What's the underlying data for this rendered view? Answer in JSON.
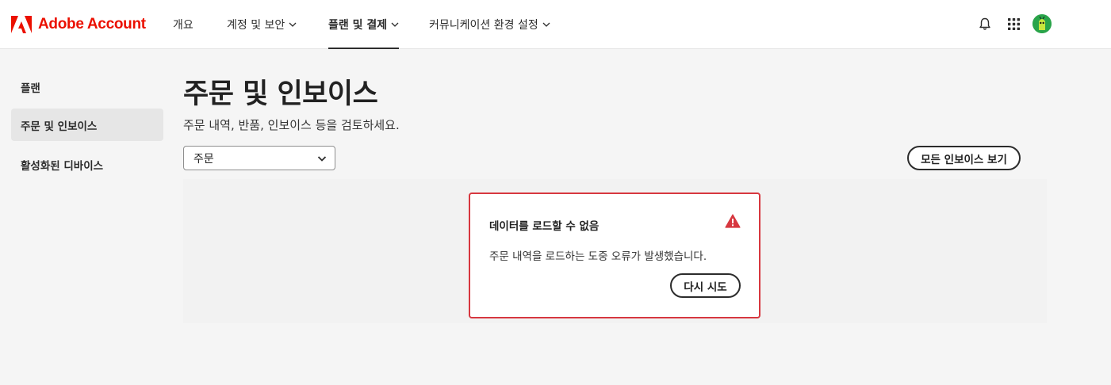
{
  "header": {
    "brand": "Adobe Account",
    "nav": [
      {
        "label": "개요",
        "has_dropdown": false
      },
      {
        "label": "계정 및 보안",
        "has_dropdown": true
      },
      {
        "label": "플랜 및 결제",
        "has_dropdown": true,
        "active": true
      },
      {
        "label": "커뮤니케이션 환경 설정",
        "has_dropdown": true
      }
    ],
    "icons": [
      "bell-icon",
      "apps-grid-icon",
      "avatar"
    ]
  },
  "sidebar": {
    "items": [
      {
        "label": "플랜"
      },
      {
        "label": "주문 및 인보이스",
        "selected": true
      },
      {
        "label": "활성화된 디바이스"
      }
    ]
  },
  "main": {
    "title": "주문 및 인보이스",
    "subtitle": "주문 내역, 반품, 인보이스 등을 검토하세요.",
    "filter": {
      "selected": "주문"
    },
    "view_all_label": "모든 인보이스 보기"
  },
  "error": {
    "title": "데이터를 로드할 수 없음",
    "message": "주문 내역을 로드하는 도중 오류가 발생했습니다.",
    "retry_label": "다시 시도"
  },
  "colors": {
    "brand": "#eb1000",
    "error_border": "#d7373f",
    "avatar_bg": "#2aa44a"
  }
}
